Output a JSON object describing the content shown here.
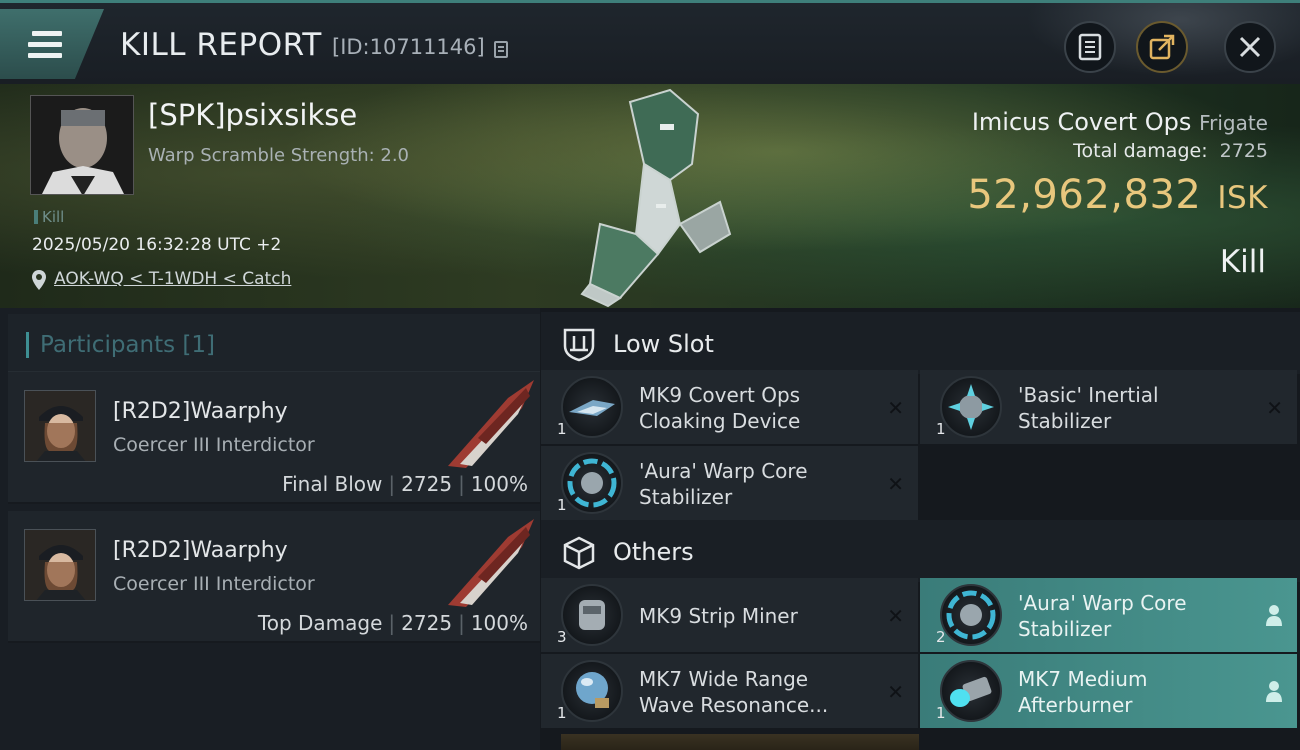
{
  "header": {
    "title": "KILL REPORT",
    "report_id": "[ID:10711146]",
    "buttons": {
      "log_icon": "clipboard-icon",
      "share_icon": "share-icon",
      "close_icon": "close-icon"
    }
  },
  "victim": {
    "name": "[SPK]psixsikse",
    "warp_scramble": "Warp Scramble Strength: 2.0",
    "kill_tag": "Kill",
    "timestamp": "2025/05/20 16:32:28 UTC +2",
    "location": "AOK-WQ < T-1WDH < Catch",
    "ship_name": "Imicus Covert Ops",
    "ship_class": "Frigate",
    "total_damage_label": "Total damage:",
    "total_damage": "2725",
    "isk_value": "52,962,832",
    "isk_unit": "ISK",
    "result": "Kill"
  },
  "participants": {
    "title": "Participants",
    "count": "[1]",
    "rows": [
      {
        "name": "[R2D2]Waarphy",
        "ship": "Coercer III Interdictor",
        "role": "Final Blow",
        "damage": "2725",
        "percent": "100%"
      },
      {
        "name": "[R2D2]Waarphy",
        "ship": "Coercer III Interdictor",
        "role": "Top Damage",
        "damage": "2725",
        "percent": "100%"
      }
    ]
  },
  "fitting": {
    "low_slot": {
      "label": "Low Slot",
      "items": [
        {
          "name": "MK9 Covert Ops Cloaking Device",
          "line1": "MK9 Covert Ops",
          "line2": "Cloaking Device",
          "qty": "1",
          "status": "destroyed"
        },
        {
          "name": "'Basic' Inertial Stabilizer",
          "line1": "'Basic' Inertial",
          "line2": "Stabilizer",
          "qty": "1",
          "status": "destroyed"
        },
        {
          "name": "'Aura' Warp Core Stabilizer",
          "line1": "'Aura' Warp Core",
          "line2": "Stabilizer",
          "qty": "1",
          "status": "destroyed"
        }
      ]
    },
    "others": {
      "label": "Others",
      "items": [
        {
          "name": "MK9 Strip Miner",
          "line1": "MK9 Strip Miner",
          "line2": "",
          "qty": "3",
          "status": "destroyed"
        },
        {
          "name": "'Aura' Warp Core Stabilizer",
          "line1": "'Aura' Warp Core",
          "line2": "Stabilizer",
          "qty": "2",
          "status": "dropped"
        },
        {
          "name": "MK7 Wide Range Wave Resonance...",
          "line1": "MK7 Wide Range",
          "line2": "Wave Resonance...",
          "qty": "1",
          "status": "destroyed"
        },
        {
          "name": "MK7 Medium Afterburner",
          "line1": "MK7 Medium",
          "line2": "Afterburner",
          "qty": "1",
          "status": "dropped"
        }
      ]
    },
    "status_glyphs": {
      "destroyed": "✕",
      "dropped": "👤"
    }
  },
  "colors": {
    "accent_teal": "#4a9690",
    "isk_gold": "#e8c77d",
    "panel": "#21272d"
  }
}
